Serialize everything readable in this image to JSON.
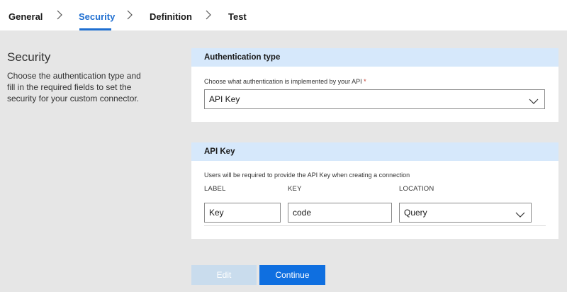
{
  "nav": {
    "steps": [
      {
        "label": "General"
      },
      {
        "label": "Security"
      },
      {
        "label": "Definition"
      },
      {
        "label": "Test"
      }
    ],
    "active_color": "#1f6fd1"
  },
  "sidebar": {
    "title": "Security",
    "description": "Choose the authentication type and fill in the required fields to set the security for your custom connector."
  },
  "auth_card": {
    "header": "Authentication type",
    "field_label": "Choose what authentication is implemented by your API",
    "required_mark": "*",
    "selected_value": "API Key"
  },
  "apikey_card": {
    "header": "API Key",
    "note": "Users will be required to provide the API Key when creating a connection",
    "columns": {
      "label": "LABEL",
      "key": "KEY",
      "location": "LOCATION"
    },
    "values": {
      "label": "Key",
      "key": "code",
      "location": "Query"
    }
  },
  "buttons": {
    "edit": "Edit",
    "continue": "Continue"
  },
  "colors": {
    "header_bg": "#d6e8fb",
    "primary": "#0f6fe0",
    "disabled": "#c9dced"
  }
}
